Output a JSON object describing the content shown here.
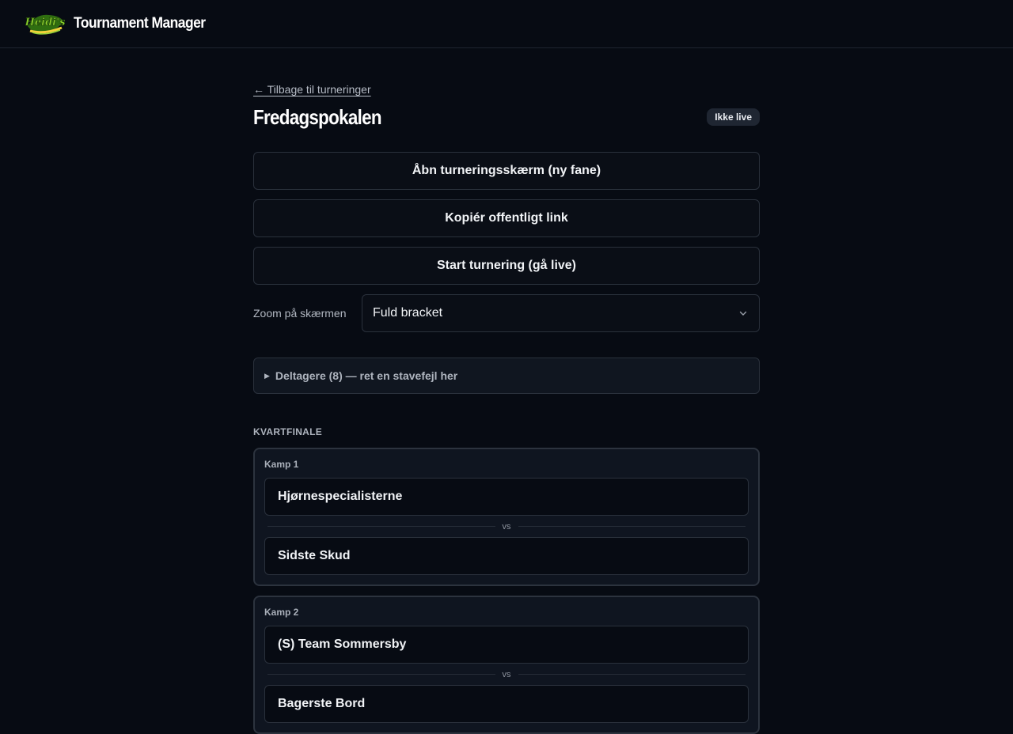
{
  "header": {
    "logo_text": "Heidi's",
    "app_title": "Tournament Manager"
  },
  "page": {
    "back_link": "← Tilbage til turneringer",
    "title": "Fredagspokalen",
    "status": "Ikke live"
  },
  "actions": {
    "open_screen": "Åbn turneringsskærm (ny fane)",
    "copy_link": "Kopiér offentligt link",
    "start": "Start turnering (gå live)"
  },
  "zoom": {
    "label": "Zoom på skærmen",
    "selected": "Fuld bracket"
  },
  "participants": {
    "summary": "Deltagere (8) — ret en stavefejl her"
  },
  "round": {
    "heading": "KVARTFINALE",
    "vs_label": "vs",
    "matches": [
      {
        "label": "Kamp 1",
        "team_a": "Hjørnespecialisterne",
        "team_b": "Sidste Skud"
      },
      {
        "label": "Kamp 2",
        "team_a": "(S) Team Sommersby",
        "team_b": "Bagerste Bord"
      }
    ]
  },
  "colors": {
    "background": "#070b13",
    "card": "#0f1520",
    "border": "#2a313c",
    "logo_green": "#7cc22a",
    "logo_yellow": "#f2d23a"
  }
}
